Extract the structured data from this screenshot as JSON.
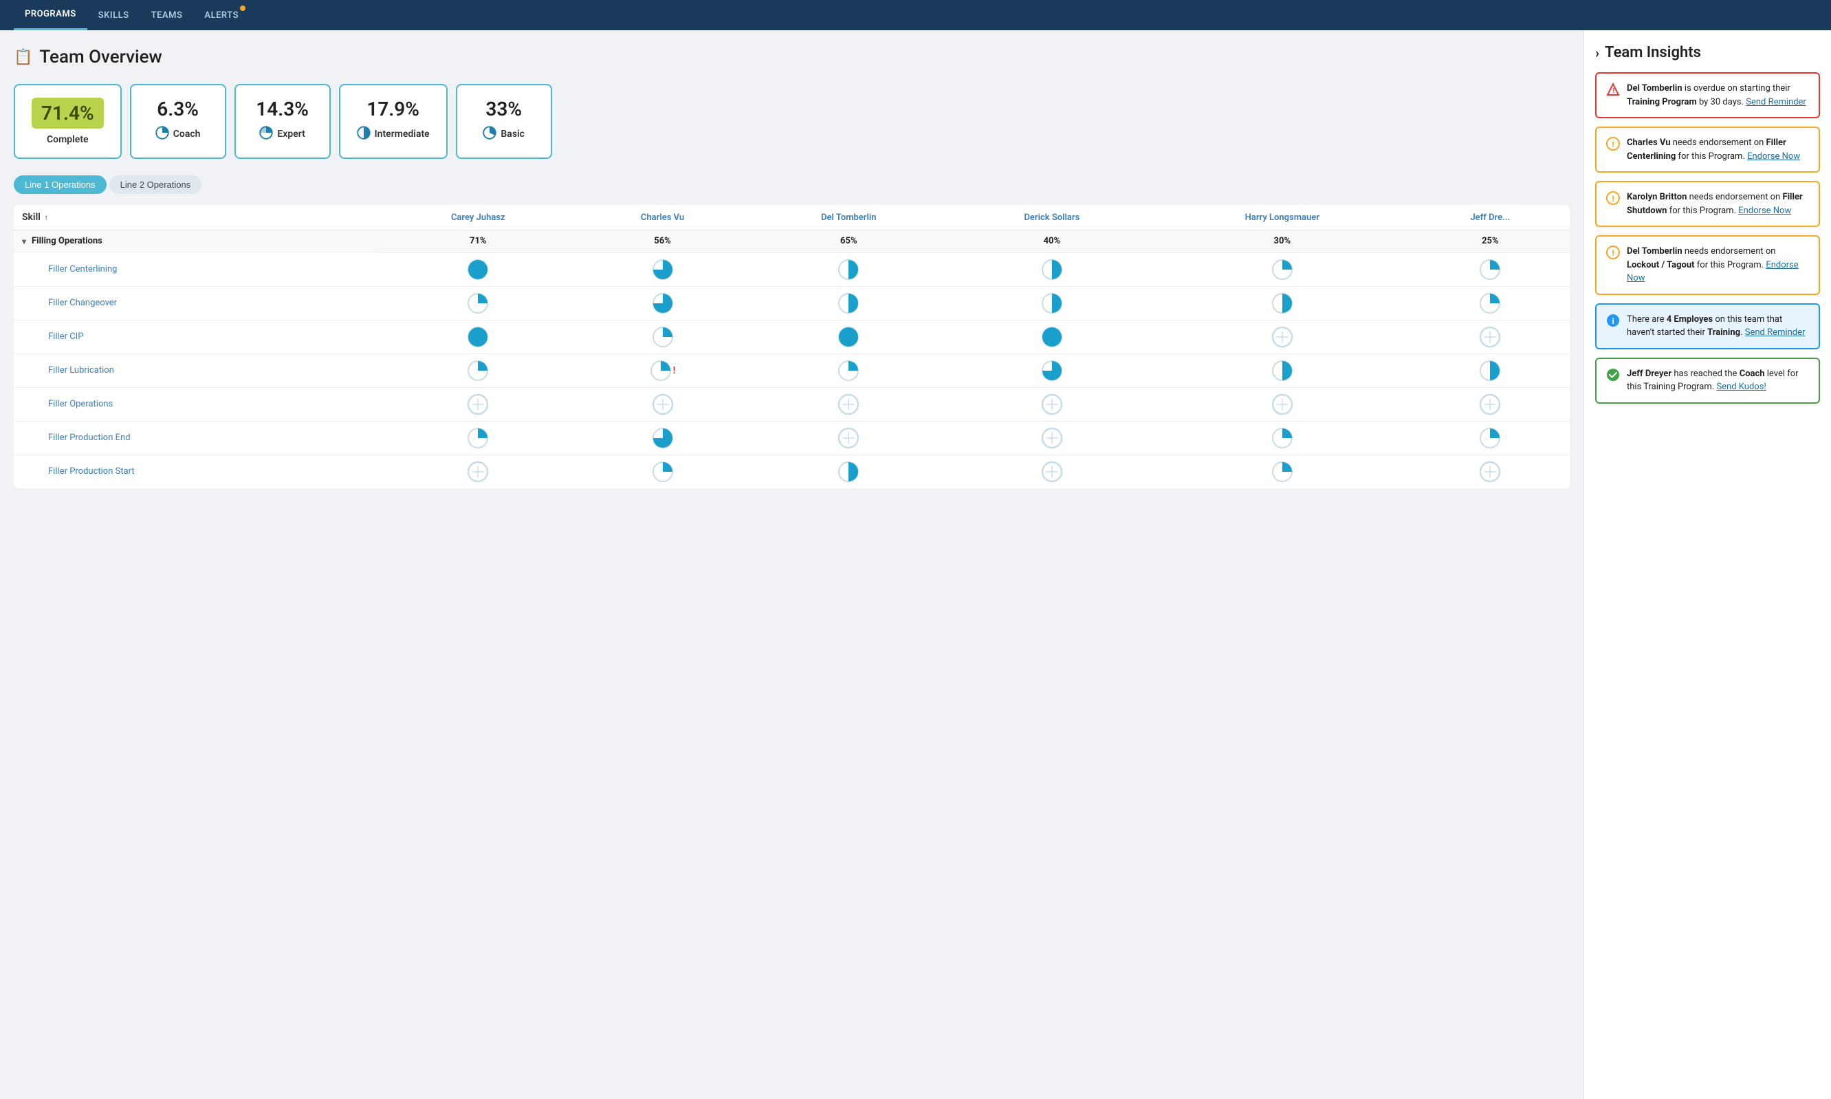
{
  "nav": {
    "items": [
      {
        "label": "PROGRAMS",
        "active": true,
        "dot": false
      },
      {
        "label": "SKILLS",
        "active": false,
        "dot": false
      },
      {
        "label": "TEAMS",
        "active": false,
        "dot": false
      },
      {
        "label": "ALERTS",
        "active": false,
        "dot": true
      }
    ]
  },
  "page": {
    "title": "Team Overview"
  },
  "stats": [
    {
      "value": "71.4%",
      "label": "Complete",
      "icon": "complete",
      "highlight": true
    },
    {
      "value": "6.3%",
      "label": "Coach",
      "icon": "coach"
    },
    {
      "value": "14.3%",
      "label": "Expert",
      "icon": "expert"
    },
    {
      "value": "17.9%",
      "label": "Intermediate",
      "icon": "intermediate"
    },
    {
      "value": "33%",
      "label": "Basic",
      "icon": "basic"
    }
  ],
  "tabs": [
    {
      "label": "Line 1 Operations",
      "active": true
    },
    {
      "label": "Line 2 Operations",
      "active": false
    }
  ],
  "table": {
    "skill_col_label": "Skill",
    "sort_arrow": "↑",
    "columns": [
      {
        "name": "Carey Juhasz"
      },
      {
        "name": "Charles Vu"
      },
      {
        "name": "Del Tomberlin"
      },
      {
        "name": "Derick Sollars"
      },
      {
        "name": "Harry Longsmauer"
      },
      {
        "name": "Jeff Dre..."
      }
    ],
    "sections": [
      {
        "name": "Filling Operations",
        "pcts": [
          "71%",
          "56%",
          "65%",
          "40%",
          "30%",
          "25%"
        ],
        "skills": [
          {
            "name": "Filler Centerlining",
            "pcts": [
              1.0,
              0.75,
              0.5,
              0.5,
              0.25,
              0.25
            ],
            "types": [
              "full",
              "threequarter",
              "half",
              "half",
              "quarter",
              "quarter"
            ],
            "exclamation": [
              false,
              false,
              false,
              false,
              false,
              false
            ]
          },
          {
            "name": "Filler Changeover",
            "pcts": [
              0.25,
              0.75,
              0.5,
              0.5,
              0.5,
              0.25
            ],
            "types": [
              "quarter",
              "threequarter",
              "half",
              "half",
              "half",
              "quarter"
            ],
            "exclamation": [
              false,
              false,
              false,
              false,
              false,
              false
            ]
          },
          {
            "name": "Filler CIP",
            "pcts": [
              1.0,
              0.25,
              1.0,
              1.0,
              0.1,
              0.1
            ],
            "types": [
              "full",
              "quarter",
              "full",
              "full",
              "empty",
              "empty"
            ],
            "exclamation": [
              false,
              false,
              false,
              false,
              false,
              false
            ]
          },
          {
            "name": "Filler Lubrication",
            "pcts": [
              0.25,
              0.25,
              0.25,
              0.75,
              0.5,
              0.5
            ],
            "types": [
              "quarter",
              "quarter",
              "quarter",
              "threequarter",
              "half",
              "half"
            ],
            "exclamation": [
              false,
              true,
              false,
              false,
              false,
              false
            ]
          },
          {
            "name": "Filler Operations",
            "pcts": [
              0.1,
              0.1,
              0.1,
              0.1,
              0.1,
              0.1
            ],
            "types": [
              "empty",
              "empty",
              "empty",
              "empty",
              "empty",
              "empty"
            ],
            "exclamation": [
              false,
              false,
              false,
              false,
              false,
              false
            ]
          },
          {
            "name": "Filler Production End",
            "pcts": [
              0.25,
              0.75,
              0.1,
              0.1,
              0.25,
              0.25
            ],
            "types": [
              "quarter",
              "threequarter",
              "empty",
              "empty",
              "quarter",
              "quarter"
            ],
            "exclamation": [
              false,
              false,
              false,
              false,
              false,
              false
            ]
          },
          {
            "name": "Filler Production Start",
            "pcts": [
              0.1,
              0.25,
              0.5,
              0.1,
              0.25,
              0.1
            ],
            "types": [
              "empty",
              "quarter",
              "half",
              "empty",
              "quarter",
              "empty"
            ],
            "exclamation": [
              false,
              false,
              false,
              false,
              false,
              false
            ]
          }
        ]
      }
    ]
  },
  "insights": {
    "title": "Team Insights",
    "cards": [
      {
        "type": "red",
        "icon": "⚠",
        "text_parts": [
          {
            "text": "Del Tomberlin",
            "bold": true
          },
          {
            "text": " is overdue on starting their "
          },
          {
            "text": "Training Program",
            "bold": true
          },
          {
            "text": " by 30 days.  "
          },
          {
            "text": "Send Reminder",
            "link": true
          }
        ]
      },
      {
        "type": "yellow",
        "icon": "!",
        "text_parts": [
          {
            "text": "Charles Vu",
            "bold": true
          },
          {
            "text": " needs endorsement on "
          },
          {
            "text": "Filler Centerlining",
            "bold": true
          },
          {
            "text": " for this Program.  "
          },
          {
            "text": "Endorse Now",
            "link": true
          }
        ]
      },
      {
        "type": "yellow",
        "icon": "!",
        "text_parts": [
          {
            "text": "Karolyn Britton",
            "bold": true
          },
          {
            "text": " needs endorsement on "
          },
          {
            "text": "Filler Shutdown",
            "bold": true
          },
          {
            "text": " for this Program.  "
          },
          {
            "text": "Endorse Now",
            "link": true
          }
        ]
      },
      {
        "type": "yellow",
        "icon": "!",
        "text_parts": [
          {
            "text": "Del Tomberlin",
            "bold": true
          },
          {
            "text": " needs endorsement on "
          },
          {
            "text": "Lockout / Tagout",
            "bold": true
          },
          {
            "text": " for this Program.  "
          },
          {
            "text": "Endorse Now",
            "link": true
          }
        ]
      },
      {
        "type": "blue",
        "icon": "ℹ",
        "text_parts": [
          {
            "text": "There are "
          },
          {
            "text": "4 Employes",
            "bold": true
          },
          {
            "text": " on this team that haven't started their "
          },
          {
            "text": "Training",
            "bold": true
          },
          {
            "text": ".  "
          },
          {
            "text": "Send Reminder",
            "link": true
          }
        ]
      },
      {
        "type": "green",
        "icon": "✓",
        "text_parts": [
          {
            "text": "Jeff Dreyer",
            "bold": true
          },
          {
            "text": " has reached the "
          },
          {
            "text": "Coach",
            "bold": true
          },
          {
            "text": " level for this Training Program.  "
          },
          {
            "text": "Send Kudos!",
            "link": true
          }
        ]
      }
    ]
  }
}
